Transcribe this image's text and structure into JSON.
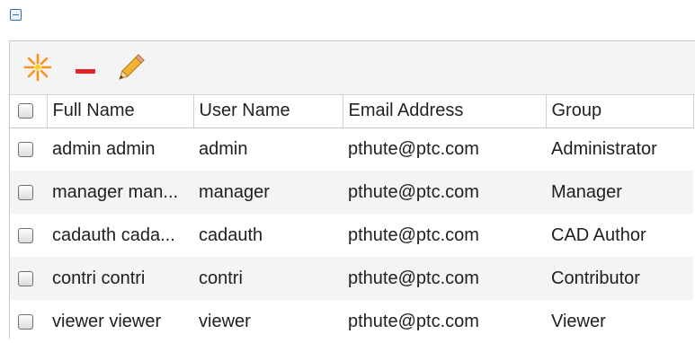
{
  "toolbar": {
    "new_icon": "starburst-new-icon",
    "remove_icon": "minus-remove-icon",
    "edit_icon": "pencil-edit-icon",
    "colors": {
      "new": "#f7931e",
      "remove": "#e2242b",
      "edit": "#f2b233"
    }
  },
  "table": {
    "columns": [
      "Full Name",
      "User Name",
      "Email Address",
      "Group"
    ],
    "rows": [
      {
        "full_name": "admin admin",
        "user_name": "admin",
        "email": "pthute@ptc.com",
        "group": "Administrator"
      },
      {
        "full_name": "manager man...",
        "user_name": "manager",
        "email": "pthute@ptc.com",
        "group": "Manager"
      },
      {
        "full_name": "cadauth cada...",
        "user_name": "cadauth",
        "email": "pthute@ptc.com",
        "group": "CAD Author"
      },
      {
        "full_name": "contri contri",
        "user_name": "contri",
        "email": "pthute@ptc.com",
        "group": "Contributor"
      },
      {
        "full_name": "viewer viewer",
        "user_name": "viewer",
        "email": "pthute@ptc.com",
        "group": "Viewer"
      }
    ]
  }
}
